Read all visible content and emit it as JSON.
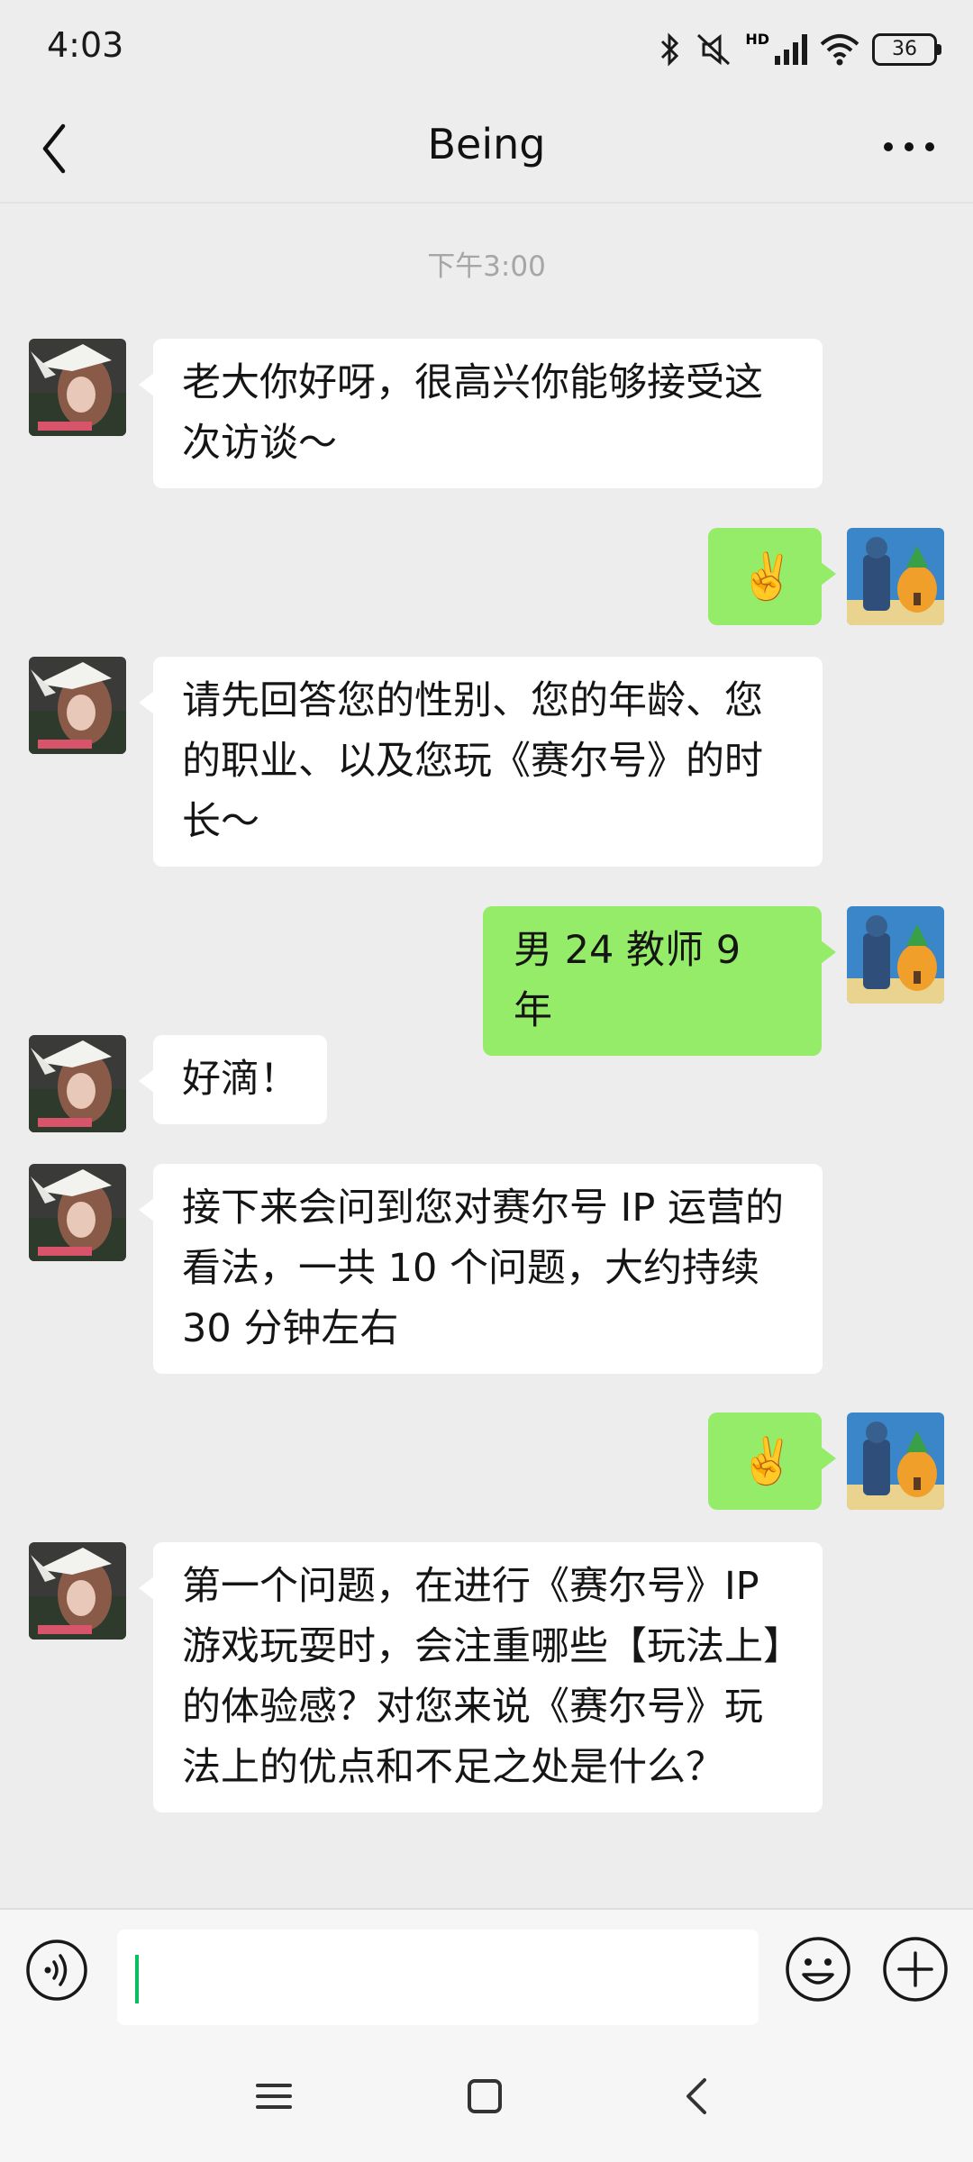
{
  "status_bar": {
    "time": "4:03",
    "network_badge": "HD",
    "battery": "36",
    "icons": [
      "bluetooth-icon",
      "mute-icon",
      "signal-icon",
      "wifi-icon",
      "battery-icon"
    ]
  },
  "header": {
    "title": "Being",
    "icons": [
      "back-arrow-icon",
      "more-icon"
    ]
  },
  "chat": {
    "timestamp": "下午3:00",
    "messages": [
      {
        "from": "other",
        "text": "老大你好呀，很高兴你能够接受这次访谈～"
      },
      {
        "from": "me",
        "text": "✌️"
      },
      {
        "from": "other",
        "text": "请先回答您的性别、您的年龄、您的职业、以及您玩《赛尔号》的时长～"
      },
      {
        "from": "me",
        "text": "男 24 教师 9 年"
      },
      {
        "from": "other",
        "text": "好滴！"
      },
      {
        "from": "other",
        "text": "接下来会问到您对赛尔号 IP 运营的看法，一共 10 个问题，大约持续 30 分钟左右"
      },
      {
        "from": "me",
        "text": "✌️"
      },
      {
        "from": "other",
        "text": "第一个问题，在进行《赛尔号》IP 游戏玩耍时，会注重哪些【玩法上】的体验感？对您来说《赛尔号》玩法上的优点和不足之处是什么？"
      }
    ]
  },
  "input_bar": {
    "value": "",
    "icons": [
      "voice-icon",
      "emoji-icon",
      "plus-icon"
    ]
  },
  "system_nav": {
    "icons": [
      "menu-icon",
      "home-icon",
      "back-icon"
    ]
  },
  "colors": {
    "background": "#ededed",
    "incoming_bubble": "#ffffff",
    "outgoing_bubble": "#95ec69",
    "caret": "#07c160"
  }
}
